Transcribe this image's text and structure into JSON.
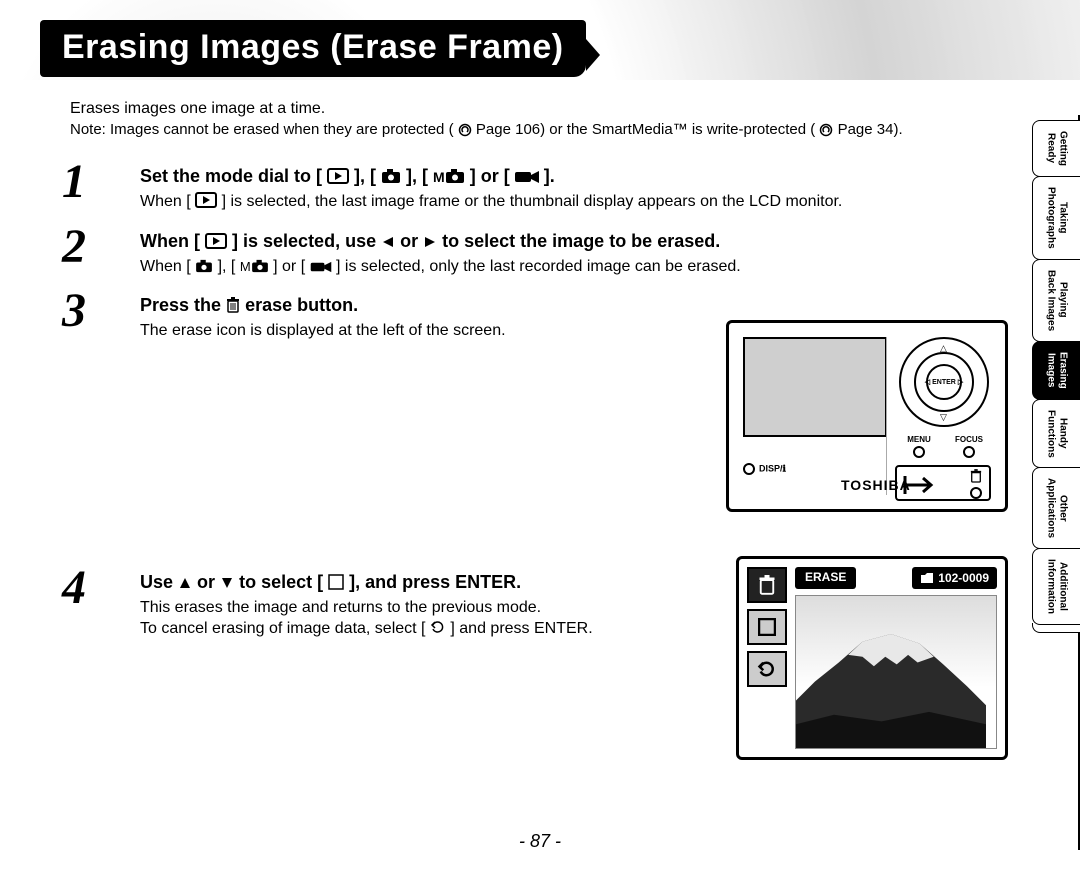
{
  "title": "Erasing Images (Erase Frame)",
  "intro": "Erases images one image at a time.",
  "noteA": "Note: Images cannot be erased when they are protected (",
  "noteB": " Page 106) or the SmartMedia™ is write-protected (",
  "noteC": " Page 34).",
  "tabs": [
    {
      "label": "Getting\nReady",
      "active": false
    },
    {
      "label": "Taking\nPhotographs",
      "active": false
    },
    {
      "label": "Playing\nBack Images",
      "active": false
    },
    {
      "label": "Erasing\nImages",
      "active": true
    },
    {
      "label": "Handy\nFunctions",
      "active": false
    },
    {
      "label": "Other\nApplications",
      "active": false
    },
    {
      "label": "Additional\nInformation",
      "active": false
    }
  ],
  "steps": [
    {
      "num": "1",
      "headA": "Set the mode dial to [ ",
      "sep": " ], [ ",
      "sep2": " ], [ ",
      "headB": " ] or [ ",
      "headC": " ].",
      "bodyA": "When [ ",
      "bodyB": " ] is selected, the last image frame or the thumbnail display appears on the LCD monitor."
    },
    {
      "num": "2",
      "headA": "When [ ",
      "headB": " ] is selected, use ",
      "headC": " or ",
      "headD": " to select the image to be erased.",
      "bodyA": "When [ ",
      "bodyB": " ], [ ",
      "bodyC": " ] or [ ",
      "bodyD": " ] is selected, only the last recorded image can be erased."
    },
    {
      "num": "3",
      "headA": "Press the ",
      "headB": " erase button.",
      "body": "The erase icon is displayed at the left of the screen."
    },
    {
      "num": "4",
      "headA": "Use ",
      "headB": " or ",
      "headC": " to select [ ",
      "headD": " ], and press ENTER.",
      "bodyA": "This erases the image and returns to the previous mode.",
      "bodyB": "To cancel erasing of image data, select [ ",
      "bodyC": " ] and press ENTER."
    }
  ],
  "camera": {
    "enter": "ENTER",
    "menu": "MENU",
    "focus": "FOCUS",
    "disp": "DISP/ℹ",
    "brand": "TOSHIBA"
  },
  "lcd": {
    "erase": "ERASE",
    "counter": "102-0009"
  },
  "pageNumber": "- 87 -"
}
